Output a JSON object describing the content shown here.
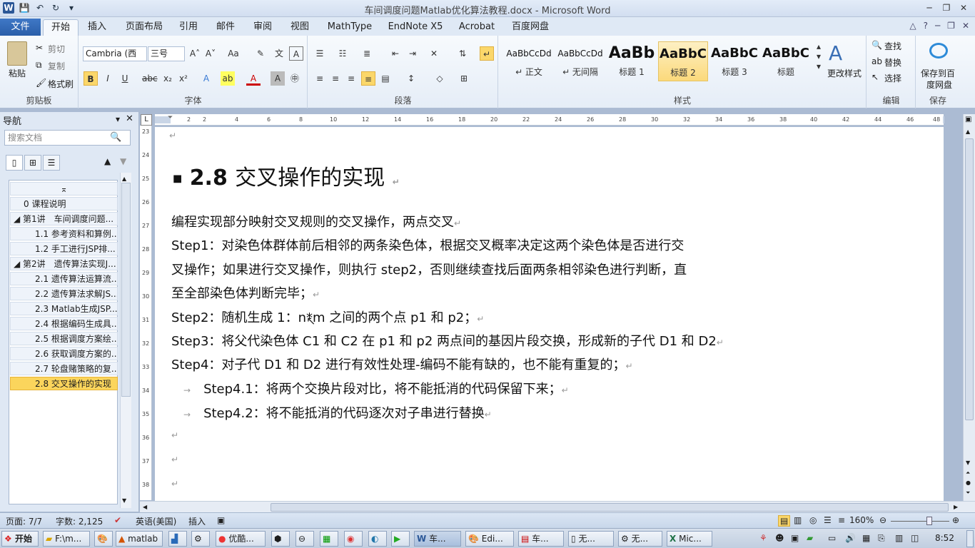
{
  "title": "车间调度问题Matlab优化算法教程.docx - Microsoft Word",
  "qat": [
    "save-icon",
    "undo-icon",
    "redo-icon",
    "customize-icon"
  ],
  "tabs": {
    "file": "文件",
    "home": "开始",
    "insert": "插入",
    "layout": "页面布局",
    "references": "引用",
    "mailings": "邮件",
    "review": "审阅",
    "view": "视图",
    "mathtype": "MathType",
    "endnote": "EndNote X5",
    "acrobat": "Acrobat",
    "baidu": "百度网盘"
  },
  "clipboard": {
    "paste": "粘贴",
    "cut": "剪切",
    "copy": "复制",
    "format_painter": "格式刷",
    "group": "剪贴板"
  },
  "font": {
    "name": "Cambria (西",
    "size": "三号",
    "group": "字体"
  },
  "paragraph": {
    "group": "段落"
  },
  "styles": {
    "items": [
      {
        "preview": "AaBbCcDd",
        "name": "↵ 正文"
      },
      {
        "preview": "AaBbCcDd",
        "name": "↵ 无间隔"
      },
      {
        "preview": "AaBb",
        "name": "标题 1"
      },
      {
        "preview": "AaBbC",
        "name": "标题 2"
      },
      {
        "preview": "AaBbC",
        "name": "标题 3"
      },
      {
        "preview": "AaBbC",
        "name": "标题"
      }
    ],
    "change": "更改样式",
    "group": "样式"
  },
  "editing": {
    "find": "查找",
    "replace": "替换",
    "select": "选择",
    "group": "编辑"
  },
  "save": {
    "label1": "保存到百",
    "label2": "度网盘",
    "group": "保存"
  },
  "nav": {
    "title": "导航",
    "search_placeholder": "搜索文档",
    "items": [
      "0 课程说明",
      "第1讲　车间调度问题...",
      "1.1 参考资料和算例...",
      "1.2 手工进行JSP排...",
      "第2讲　遗传算法实现J...",
      "2.1 遗传算法运算流...",
      "2.2 遗传算法求解JS...",
      "2.3 Matlab生成JSP...",
      "2.4 根据编码生成具...",
      "2.5 根据调度方案绘...",
      "2.6 获取调度方案的...",
      "2.7 轮盘赌策略的复...",
      "2.8 交叉操作的实现"
    ]
  },
  "ruler": {
    "h": [
      "2",
      "2",
      "4",
      "6",
      "8",
      "10",
      "12",
      "14",
      "16",
      "18",
      "20",
      "22",
      "24",
      "26",
      "28",
      "30",
      "32",
      "34",
      "36",
      "38",
      "40",
      "42",
      "44",
      "46",
      "48"
    ],
    "v": [
      "23",
      "24",
      "25",
      "26",
      "27",
      "28",
      "29",
      "30",
      "31",
      "32",
      "33",
      "34",
      "35",
      "36",
      "37",
      "38"
    ]
  },
  "doc": {
    "heading_num": "2.8",
    "heading_text": "交叉操作的实现",
    "p1": "编程实现部分映射交叉规则的交叉操作，两点交叉",
    "p2a": "Step1：对染色体群体前后相邻的两条染色体，根据交叉概率决定这两个染色体是否进行交",
    "p2b": "叉操作；如果进行交叉操作，则执行 step2，否则继续查找后面两条相邻染色进行判断，直",
    "p2c": "至全部染色体判断完毕；",
    "p3": "Step2：随机生成 1：n*m 之间的两个点 p1 和 p2；",
    "p4": "Step3：将父代染色体 C1 和 C2 在 p1 和 p2 两点间的基因片段交换，形成新的子代 D1 和 D2",
    "p5": "Step4：对子代 D1 和 D2 进行有效性处理-编码不能有缺的，也不能有重复的；",
    "p6": "Step4.1：将两个交换片段对比，将不能抵消的代码保留下来；",
    "p7": "Step4.2：将不能抵消的代码逐次对子串进行替换",
    "pm": "↵",
    "tab": "→"
  },
  "status": {
    "page": "页面: 7/7",
    "words": "字数: 2,125",
    "lang": "英语(美国)",
    "mode": "插入",
    "zoom": "160%"
  },
  "taskbar": {
    "start": "开始",
    "items": [
      "F:\\m...",
      "",
      "matlab",
      "",
      "",
      "",
      "优酷...",
      "",
      "",
      "",
      "",
      "",
      "车...",
      "Edi...",
      "车...",
      "无...",
      "无...",
      "Mic..."
    ],
    "time": "8:52"
  }
}
